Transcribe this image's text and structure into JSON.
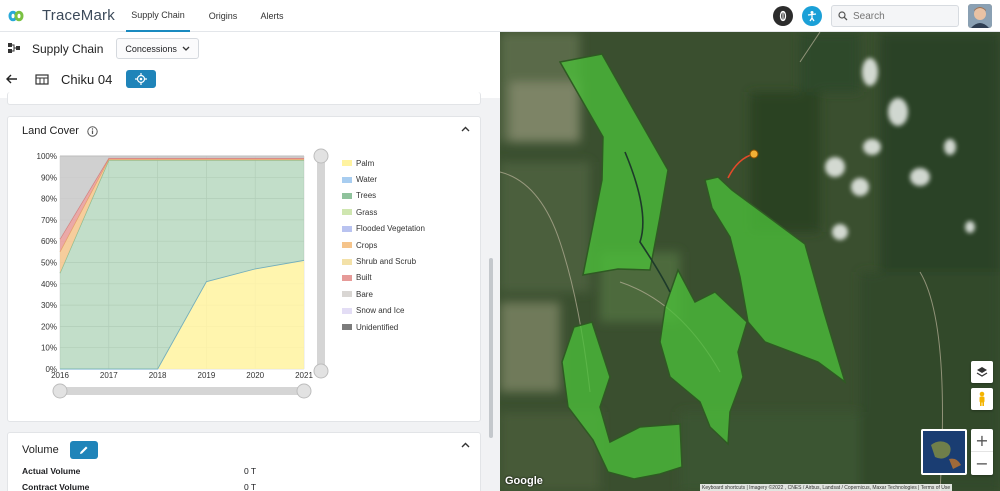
{
  "app": {
    "name": "TraceMark"
  },
  "nav": {
    "tabs": [
      {
        "label": "Supply Chain"
      },
      {
        "label": "Origins"
      },
      {
        "label": "Alerts"
      }
    ]
  },
  "search": {
    "placeholder": "Search"
  },
  "panel": {
    "title": "Supply Chain",
    "dropdown_value": "Concessions",
    "entity_name": "Chiku 04"
  },
  "land_cover": {
    "title": "Land Cover",
    "legend": [
      {
        "label": "Palm",
        "color": "#fff3a0"
      },
      {
        "label": "Water",
        "color": "#a8cdf0"
      },
      {
        "label": "Trees",
        "color": "#8fc29c"
      },
      {
        "label": "Grass",
        "color": "#cfe6b0"
      },
      {
        "label": "Flooded Vegetation",
        "color": "#b9c3f0"
      },
      {
        "label": "Crops",
        "color": "#f5c48b"
      },
      {
        "label": "Shrub and Scrub",
        "color": "#f3e1a8"
      },
      {
        "label": "Built",
        "color": "#e69a98"
      },
      {
        "label": "Bare",
        "color": "#d9d6d3"
      },
      {
        "label": "Snow and Ice",
        "color": "#e3ddf5"
      },
      {
        "label": "Unidentified",
        "color": "#7c7c7c"
      }
    ]
  },
  "chart_data": {
    "type": "area",
    "title": "Land Cover",
    "x": [
      "2016",
      "2017",
      "2018",
      "2019",
      "2020",
      "2021"
    ],
    "ylim": [
      0,
      100
    ],
    "y_ticks": [
      "0%",
      "10%",
      "20%",
      "30%",
      "40%",
      "50%",
      "60%",
      "70%",
      "80%",
      "90%",
      "100%"
    ],
    "stacking": "percent",
    "series": [
      {
        "name": "Palm",
        "values": [
          0,
          0,
          0,
          41,
          47,
          51
        ]
      },
      {
        "name": "Trees",
        "values": [
          45,
          98,
          98,
          57,
          51,
          47
        ]
      },
      {
        "name": "Crops",
        "values": [
          10,
          0.5,
          0.5,
          0.5,
          0.5,
          0.5
        ]
      },
      {
        "name": "Built",
        "values": [
          6,
          0.5,
          0.5,
          0.5,
          0.5,
          0.5
        ]
      },
      {
        "name": "Unidentified",
        "values": [
          39,
          1,
          1,
          1,
          1,
          1
        ]
      }
    ]
  },
  "volume": {
    "title": "Volume",
    "rows": [
      {
        "label": "Actual Volume",
        "value": "0 T"
      },
      {
        "label": "Contract Volume",
        "value": "0 T"
      }
    ]
  },
  "map": {
    "attribution": "Keyboard shortcuts | Imagery ©2022 , CNES / Airbus, Landsat / Copernicus, Maxar Technologies | Terms of Use",
    "brand": "Google",
    "zoom_in": "+",
    "zoom_out": "−"
  }
}
